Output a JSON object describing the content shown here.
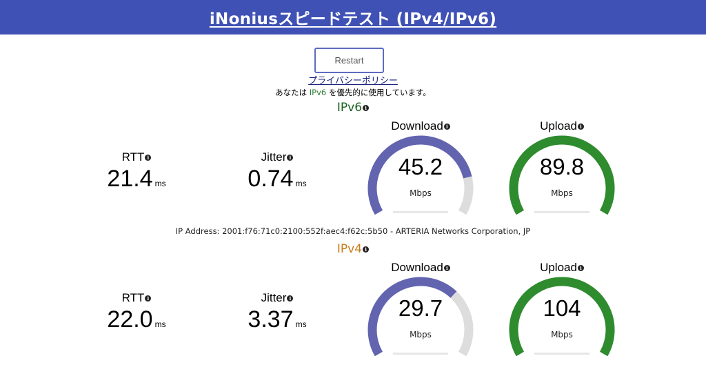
{
  "header": {
    "title": "iNoniusスピードテスト (IPv4/IPv6)"
  },
  "controls": {
    "restart_label": "Restart",
    "privacy_label": "プライバシーポリシー"
  },
  "preference": {
    "prefix": "あなたは ",
    "mode": "IPv6",
    "suffix": " を優先的に使用しています。"
  },
  "ipv6": {
    "title": "IPv6",
    "rtt": {
      "label": "RTT",
      "value": "21.4",
      "unit": "ms"
    },
    "jitter": {
      "label": "Jitter",
      "value": "0.74",
      "unit": "ms"
    },
    "download": {
      "label": "Download",
      "value": "45.2",
      "unit": "Mbps",
      "fill": 0.82
    },
    "upload": {
      "label": "Upload",
      "value": "89.8",
      "unit": "Mbps",
      "fill": 1.0
    }
  },
  "ip_address_text": "IP Address: 2001:f76:71c0:2100:552f:aec4:f62c:5b50 - ARTERIA Networks Corporation, JP",
  "ipv4": {
    "title": "IPv4",
    "rtt": {
      "label": "RTT",
      "value": "22.0",
      "unit": "ms"
    },
    "jitter": {
      "label": "Jitter",
      "value": "3.37",
      "unit": "ms"
    },
    "download": {
      "label": "Download",
      "value": "29.7",
      "unit": "Mbps",
      "fill": 0.68
    },
    "upload": {
      "label": "Upload",
      "value": "104",
      "unit": "Mbps",
      "fill": 1.0
    }
  },
  "colors": {
    "header_bg": "#3f51b5",
    "download_arc": "#6264b0",
    "upload_arc": "#2e8b2e",
    "track": "#dddddd",
    "ipv6_title": "#1b5e20",
    "ipv4_title": "#c67c1a"
  },
  "icons": {
    "info": "info-icon"
  }
}
